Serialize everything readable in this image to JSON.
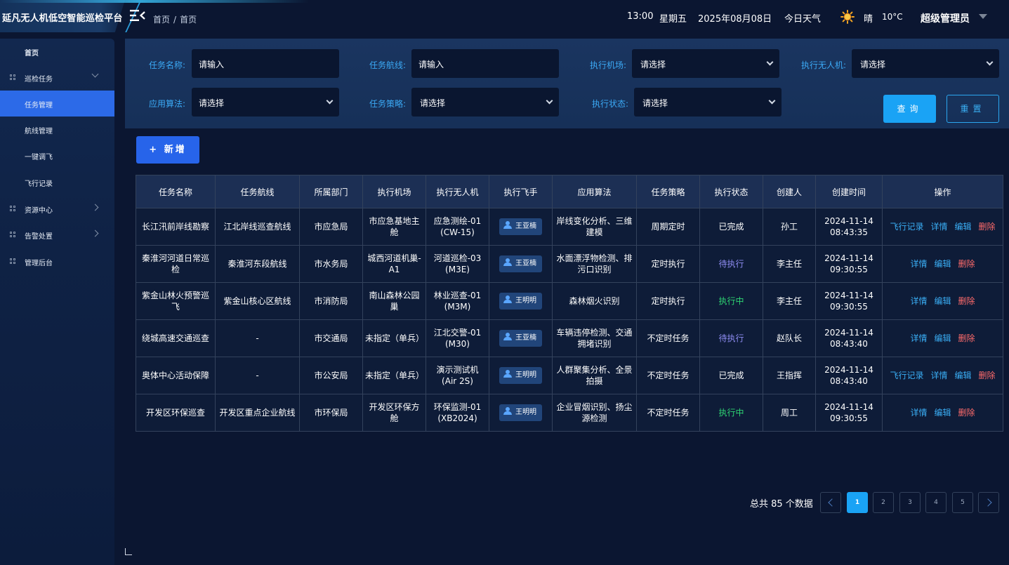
{
  "app": {
    "title": "延凡无人机低空智能巡检平台"
  },
  "breadcrumb": {
    "home": "首页",
    "sep": "/",
    "current": "首页"
  },
  "header": {
    "time": "13:00",
    "weekday": "星期五",
    "date": "2025年08月08日",
    "weather_label": "今日天气",
    "weather_icon": "sun-icon",
    "weather": "晴",
    "temperature": "10°C",
    "user": "超级管理员"
  },
  "sidebar": {
    "items": [
      {
        "label": "首页",
        "level": "top"
      },
      {
        "label": "巡检任务",
        "icon": "grid-icon",
        "expanded": true
      },
      {
        "label": "任务管理",
        "active": true
      },
      {
        "label": "航线管理"
      },
      {
        "label": "一键调飞"
      },
      {
        "label": "飞行记录"
      },
      {
        "label": "资源中心",
        "icon": "grid-icon"
      },
      {
        "label": "告警处置",
        "icon": "grid-icon"
      },
      {
        "label": "管理后台",
        "icon": "grid-icon"
      }
    ]
  },
  "filters": {
    "task_name": {
      "label": "任务名称:",
      "placeholder": "请输入"
    },
    "task_route": {
      "label": "任务航线:",
      "placeholder": "请输入"
    },
    "airport": {
      "label": "执行机场:",
      "value": "请选择"
    },
    "drone": {
      "label": "执行无人机:",
      "value": "请选择"
    },
    "algorithm": {
      "label": "应用算法:",
      "value": "请选择"
    },
    "strategy": {
      "label": "任务策略:",
      "value": "请选择"
    },
    "status": {
      "label": "执行状态:",
      "value": "请选择"
    },
    "query_label": "查询",
    "reset_label": "重置"
  },
  "toolbar": {
    "add_label": "+ 新增"
  },
  "table": {
    "columns": [
      "任务名称",
      "任务航线",
      "所属部门",
      "执行机场",
      "执行无人机",
      "执行飞手",
      "应用算法",
      "任务策略",
      "执行状态",
      "创建人",
      "创建时间",
      "操作"
    ],
    "rows": [
      {
        "name": "长江汛前岸线勘察",
        "route": "江北岸线巡查航线",
        "dept": "市应急局",
        "airport": "市应急基地主舱",
        "drone": "应急测绘-01 (CW-15)",
        "pilot": "王亚楠",
        "algorithm": "岸线变化分析、三维建模",
        "strategy": "周期定时",
        "status": "已完成",
        "status_type": "done",
        "creator": "孙工",
        "created": "2024-11-14 08:43:35",
        "ops": [
          "飞行记录",
          "详情",
          "编辑",
          "删除"
        ]
      },
      {
        "name": "秦淮河河道日常巡检",
        "route": "秦淮河东段航线",
        "dept": "市水务局",
        "airport": "城西河道机巢-A1",
        "drone": "河道巡检-03 (M3E)",
        "pilot": "王亚楠",
        "algorithm": "水面漂浮物检测、排污口识别",
        "strategy": "定时执行",
        "status": "待执行",
        "status_type": "wait",
        "creator": "李主任",
        "created": "2024-11-14 09:30:55",
        "ops": [
          "详情",
          "编辑",
          "删除"
        ]
      },
      {
        "name": "紫金山林火预警巡飞",
        "route": "紫金山核心区航线",
        "dept": "市消防局",
        "airport": "南山森林公园巢",
        "drone": "林业巡查-01 (M3M)",
        "pilot": "王明明",
        "algorithm": "森林烟火识别",
        "strategy": "定时执行",
        "status": "执行中",
        "status_type": "run",
        "creator": "李主任",
        "created": "2024-11-14 09:30:55",
        "ops": [
          "详情",
          "编辑",
          "删除"
        ]
      },
      {
        "name": "绕城高速交通巡查",
        "route": "-",
        "dept": "市交通局",
        "airport": "未指定（单兵）",
        "drone": "江北交警-01 (M30)",
        "pilot": "王亚楠",
        "algorithm": "车辆违停检测、交通拥堵识别",
        "strategy": "不定时任务",
        "status": "待执行",
        "status_type": "wait",
        "creator": "赵队长",
        "created": "2024-11-14 08:43:40",
        "ops": [
          "详情",
          "编辑",
          "删除"
        ]
      },
      {
        "name": "奥体中心活动保障",
        "route": "-",
        "dept": "市公安局",
        "airport": "未指定（单兵）",
        "drone": "演示测试机 (Air 2S)",
        "pilot": "王明明",
        "algorithm": "人群聚集分析、全景拍摄",
        "strategy": "不定时任务",
        "status": "已完成",
        "status_type": "done",
        "creator": "王指挥",
        "created": "2024-11-14 08:43:40",
        "ops": [
          "飞行记录",
          "详情",
          "编辑",
          "删除"
        ]
      },
      {
        "name": "开发区环保巡查",
        "route": "开发区重点企业航线",
        "dept": "市环保局",
        "airport": "开发区环保方舱",
        "drone": "环保监测-01 (XB2024)",
        "pilot": "王明明",
        "algorithm": "企业冒烟识别、扬尘源检测",
        "strategy": "不定时任务",
        "status": "执行中",
        "status_type": "run",
        "creator": "周工",
        "created": "2024-11-14 09:30:55",
        "ops": [
          "详情",
          "编辑",
          "删除"
        ]
      }
    ]
  },
  "pagination": {
    "total_text": "总共 85 个数据",
    "current_page": 1,
    "pages": [
      "1",
      "2",
      "3",
      "4",
      "5"
    ]
  }
}
